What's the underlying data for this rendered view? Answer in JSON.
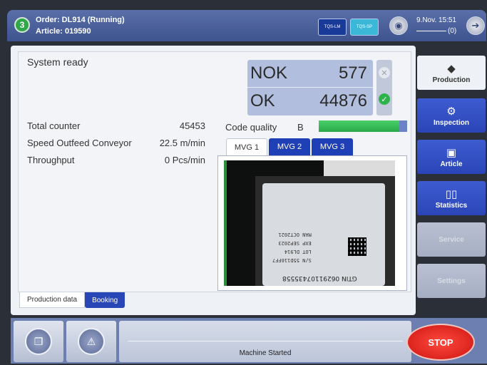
{
  "header": {
    "step_number": "3",
    "order": "Order:  DL914 (Running)",
    "article": "Article: 019590",
    "tqs_lm": "TQS-LM",
    "tqs_sp": "TQS-SP",
    "datetime": "9.Nov. 15:51",
    "counter": "(0)"
  },
  "main": {
    "status": "System ready",
    "nok_label": "NOK",
    "nok_value": "577",
    "ok_label": "OK",
    "ok_value": "44876",
    "stats": [
      {
        "label": "Total counter",
        "value": "45453"
      },
      {
        "label": "Speed Outfeed Conveyor",
        "value": "22.5 m/min"
      },
      {
        "label": "Throughput",
        "value": "0 Pcs/min"
      }
    ],
    "code_quality_label": "Code quality",
    "code_quality_grade": "B",
    "code_quality_level": 0.91,
    "tabs": [
      "MVG 1",
      "MVG 2",
      "MVG 3"
    ],
    "label_text": {
      "line1": "S/N  55D116FF7",
      "line2": "LOT  DL914",
      "line3": "EXP  SEP2023",
      "line4": "MAN  OCT2021",
      "gtin": "GTIN 06291107435558"
    },
    "bottom_tabs": [
      "Production data",
      "Booking"
    ]
  },
  "sidebar": {
    "items": [
      {
        "label": "Production",
        "icon": "diamond-icon"
      },
      {
        "label": "Inspection",
        "icon": "inspection-icon"
      },
      {
        "label": "Article",
        "icon": "box-icon"
      },
      {
        "label": "Statistics",
        "icon": "bar-chart-icon"
      },
      {
        "label": "Service",
        "icon": ""
      },
      {
        "label": "Settings",
        "icon": ""
      }
    ]
  },
  "footer": {
    "message": "Machine Started",
    "stop_label": "STOP"
  },
  "colors": {
    "accent_blue": "#2a45b8",
    "ok_green": "#2eb24a",
    "stop_red": "#d81a12"
  }
}
